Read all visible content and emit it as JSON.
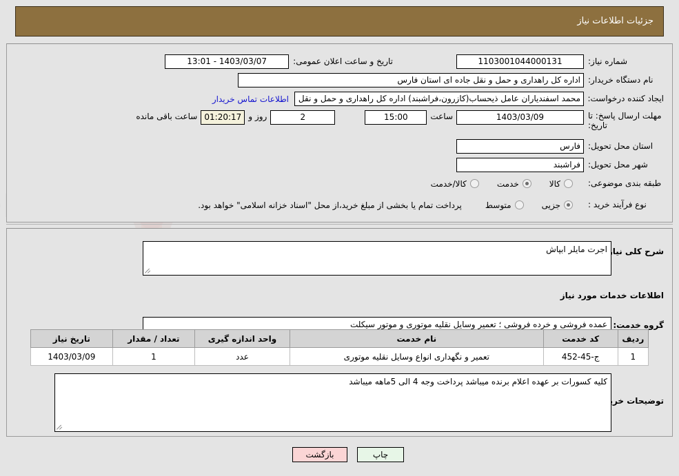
{
  "header": {
    "title": "جزئیات اطلاعات نیاز"
  },
  "top_panel": {
    "need_number_label": "شماره نیاز:",
    "need_number_value": "1103001044000131",
    "announce_datetime_label": "تاریخ و ساعت اعلان عمومی:",
    "announce_datetime_value": "1403/03/07 - 13:01",
    "buyer_org_label": "نام دستگاه خریدار:",
    "buyer_org_value": "اداره کل راهداری و حمل و نقل جاده ای استان فارس",
    "requester_label": "ایجاد کننده درخواست:",
    "requester_value": "محمد اسفندیاران عامل ذیحساب(کازرون،فراشبند) اداره کل راهداری و حمل و نقل",
    "contact_link": "اطلاعات تماس خریدار",
    "deadline_label_line1": "مهلت ارسال پاسخ: تا",
    "deadline_label_line2": "تاریخ:",
    "deadline_date_value": "1403/03/09",
    "time_word": "ساعت",
    "deadline_time_value": "15:00",
    "remaining_days_value": "2",
    "days_word": "روز و",
    "countdown_value": "01:20:17",
    "remaining_hours_text": "ساعت باقی مانده",
    "province_label": "استان محل تحویل:",
    "province_value": "فارس",
    "city_label": "شهر محل تحویل:",
    "city_value": "فراشبند",
    "category_label": "طبقه بندی موضوعی:",
    "category_options": [
      {
        "label": "کالا",
        "selected": false
      },
      {
        "label": "خدمت",
        "selected": true
      },
      {
        "label": "کالا/خدمت",
        "selected": false
      }
    ],
    "purchase_type_label": "نوع فرآیند خرید :",
    "purchase_type_options": [
      {
        "label": "جزیی",
        "selected": true
      },
      {
        "label": "متوسط",
        "selected": false
      }
    ],
    "payment_note": "پرداخت تمام یا بخشی از مبلغ خرید،از محل \"اسناد خزانه اسلامی\" خواهد بود."
  },
  "middle_panel": {
    "general_desc_label": "شرح کلی نیاز:",
    "general_desc_value": "اجرت مایلر ابپاش",
    "services_info_heading": "اطلاعات خدمات مورد نیاز",
    "service_group_label": "گروه خدمت:",
    "service_group_value": "عمده فروشی و خرده فروشی ؛ تعمیر وسایل نقلیه موتوری و موتور سیکلت",
    "buyer_notes_label": "توضیحات خریدار:",
    "buyer_notes_value": "کلیه کسورات بر عهده اعلام برنده میباشد پرداخت وجه 4 الی 5ماهه میباشد"
  },
  "table": {
    "columns": [
      "ردیف",
      "کد خدمت",
      "نام خدمت",
      "واحد اندازه گیری",
      "تعداد / مقدار",
      "تاریخ نیاز"
    ],
    "rows": [
      {
        "index": "1",
        "service_code": "ج-45-452",
        "service_name": "تعمیر و نگهداری انواع وسایل نقلیه موتوری",
        "unit": "عدد",
        "quantity": "1",
        "need_date": "1403/03/09"
      }
    ]
  },
  "footer": {
    "print_label": "چاپ",
    "back_label": "بازگشت"
  },
  "watermark": {
    "text": "AnaTender.net"
  },
  "colors": {
    "header_brown": "#8d703f",
    "page_bg": "#e4e4e4",
    "link_blue": "#1414cf",
    "countdown_bg": "#f5f2dc",
    "print_btn_bg": "#e7f6e7",
    "back_btn_bg": "#fbd5d5",
    "table_header_bg": "#d4d4d4"
  }
}
